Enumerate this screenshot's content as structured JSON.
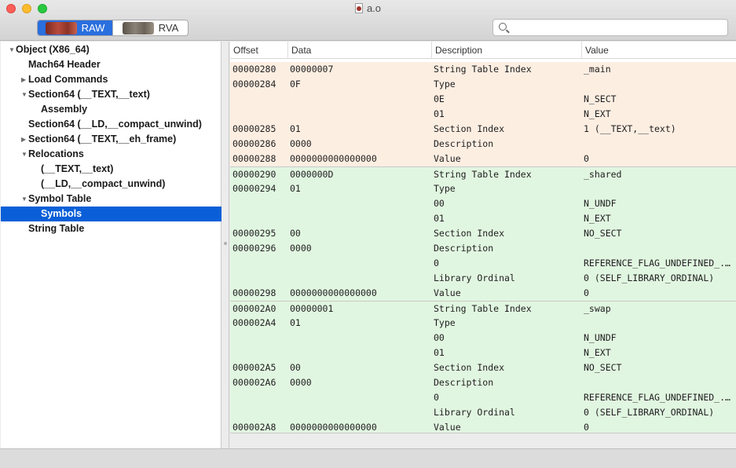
{
  "window": {
    "title": "a.o"
  },
  "toolbar": {
    "segments": [
      {
        "label": "RAW",
        "active": true
      },
      {
        "label": "RVA",
        "active": false
      }
    ],
    "search": {
      "value": "",
      "placeholder": ""
    }
  },
  "outline": {
    "items": [
      {
        "label": "Object  (X86_64)",
        "level": 0,
        "disclosure": "expanded"
      },
      {
        "label": "Mach64 Header",
        "level": 1,
        "disclosure": "none"
      },
      {
        "label": "Load Commands",
        "level": 1,
        "disclosure": "collapsed"
      },
      {
        "label": "Section64 (__TEXT,__text)",
        "level": 1,
        "disclosure": "expanded"
      },
      {
        "label": "Assembly",
        "level": 2,
        "disclosure": "none"
      },
      {
        "label": "Section64 (__LD,__compact_unwind)",
        "level": 1,
        "disclosure": "none"
      },
      {
        "label": "Section64 (__TEXT,__eh_frame)",
        "level": 1,
        "disclosure": "collapsed"
      },
      {
        "label": "Relocations",
        "level": 1,
        "disclosure": "expanded"
      },
      {
        "label": "(__TEXT,__text)",
        "level": 2,
        "disclosure": "none"
      },
      {
        "label": "(__LD,__compact_unwind)",
        "level": 2,
        "disclosure": "none"
      },
      {
        "label": "Symbol Table",
        "level": 1,
        "disclosure": "expanded"
      },
      {
        "label": "Symbols",
        "level": 2,
        "disclosure": "none",
        "selected": true
      },
      {
        "label": "String Table",
        "level": 1,
        "disclosure": "none"
      }
    ]
  },
  "table": {
    "columns": [
      "Offset",
      "Data",
      "Description",
      "Value"
    ],
    "rows": [
      {
        "offset": "00000280",
        "data": "00000007",
        "desc": "String Table Index",
        "value": "_main",
        "tint": "peach",
        "block_start": false
      },
      {
        "offset": "00000284",
        "data": "0F",
        "desc": "Type",
        "value": "",
        "tint": "peach"
      },
      {
        "offset": "",
        "data": "",
        "desc": "0E",
        "value": "N_SECT",
        "tint": "peach"
      },
      {
        "offset": "",
        "data": "",
        "desc": "01",
        "value": "N_EXT",
        "tint": "peach"
      },
      {
        "offset": "00000285",
        "data": "01",
        "desc": "Section Index",
        "value": "1 (__TEXT,__text)",
        "tint": "peach"
      },
      {
        "offset": "00000286",
        "data": "0000",
        "desc": "Description",
        "value": "",
        "tint": "peach"
      },
      {
        "offset": "00000288",
        "data": "0000000000000000",
        "desc": "Value",
        "value": "0",
        "tint": "peach"
      },
      {
        "offset": "00000290",
        "data": "0000000D",
        "desc": "String Table Index",
        "value": "_shared",
        "tint": "green",
        "block_start": true
      },
      {
        "offset": "00000294",
        "data": "01",
        "desc": "Type",
        "value": "",
        "tint": "green"
      },
      {
        "offset": "",
        "data": "",
        "desc": "00",
        "value": "N_UNDF",
        "tint": "green"
      },
      {
        "offset": "",
        "data": "",
        "desc": "01",
        "value": "N_EXT",
        "tint": "green"
      },
      {
        "offset": "00000295",
        "data": "00",
        "desc": "Section Index",
        "value": "NO_SECT",
        "tint": "green"
      },
      {
        "offset": "00000296",
        "data": "0000",
        "desc": "Description",
        "value": "",
        "tint": "green"
      },
      {
        "offset": "",
        "data": "",
        "desc": "0",
        "value": "REFERENCE_FLAG_UNDEFINED_...",
        "tint": "green"
      },
      {
        "offset": "",
        "data": "",
        "desc": "Library Ordinal",
        "value": "0 (SELF_LIBRARY_ORDINAL)",
        "tint": "green"
      },
      {
        "offset": "00000298",
        "data": "0000000000000000",
        "desc": "Value",
        "value": "0",
        "tint": "green"
      },
      {
        "offset": "000002A0",
        "data": "00000001",
        "desc": "String Table Index",
        "value": "_swap",
        "tint": "green",
        "block_start": true
      },
      {
        "offset": "000002A4",
        "data": "01",
        "desc": "Type",
        "value": "",
        "tint": "green"
      },
      {
        "offset": "",
        "data": "",
        "desc": "00",
        "value": "N_UNDF",
        "tint": "green"
      },
      {
        "offset": "",
        "data": "",
        "desc": "01",
        "value": "N_EXT",
        "tint": "green"
      },
      {
        "offset": "000002A5",
        "data": "00",
        "desc": "Section Index",
        "value": "NO_SECT",
        "tint": "green"
      },
      {
        "offset": "000002A6",
        "data": "0000",
        "desc": "Description",
        "value": "",
        "tint": "green"
      },
      {
        "offset": "",
        "data": "",
        "desc": "0",
        "value": "REFERENCE_FLAG_UNDEFINED_...",
        "tint": "green"
      },
      {
        "offset": "",
        "data": "",
        "desc": "Library Ordinal",
        "value": "0 (SELF_LIBRARY_ORDINAL)",
        "tint": "green"
      },
      {
        "offset": "000002A8",
        "data": "0000000000000000",
        "desc": "Value",
        "value": "0",
        "tint": "green"
      }
    ]
  }
}
